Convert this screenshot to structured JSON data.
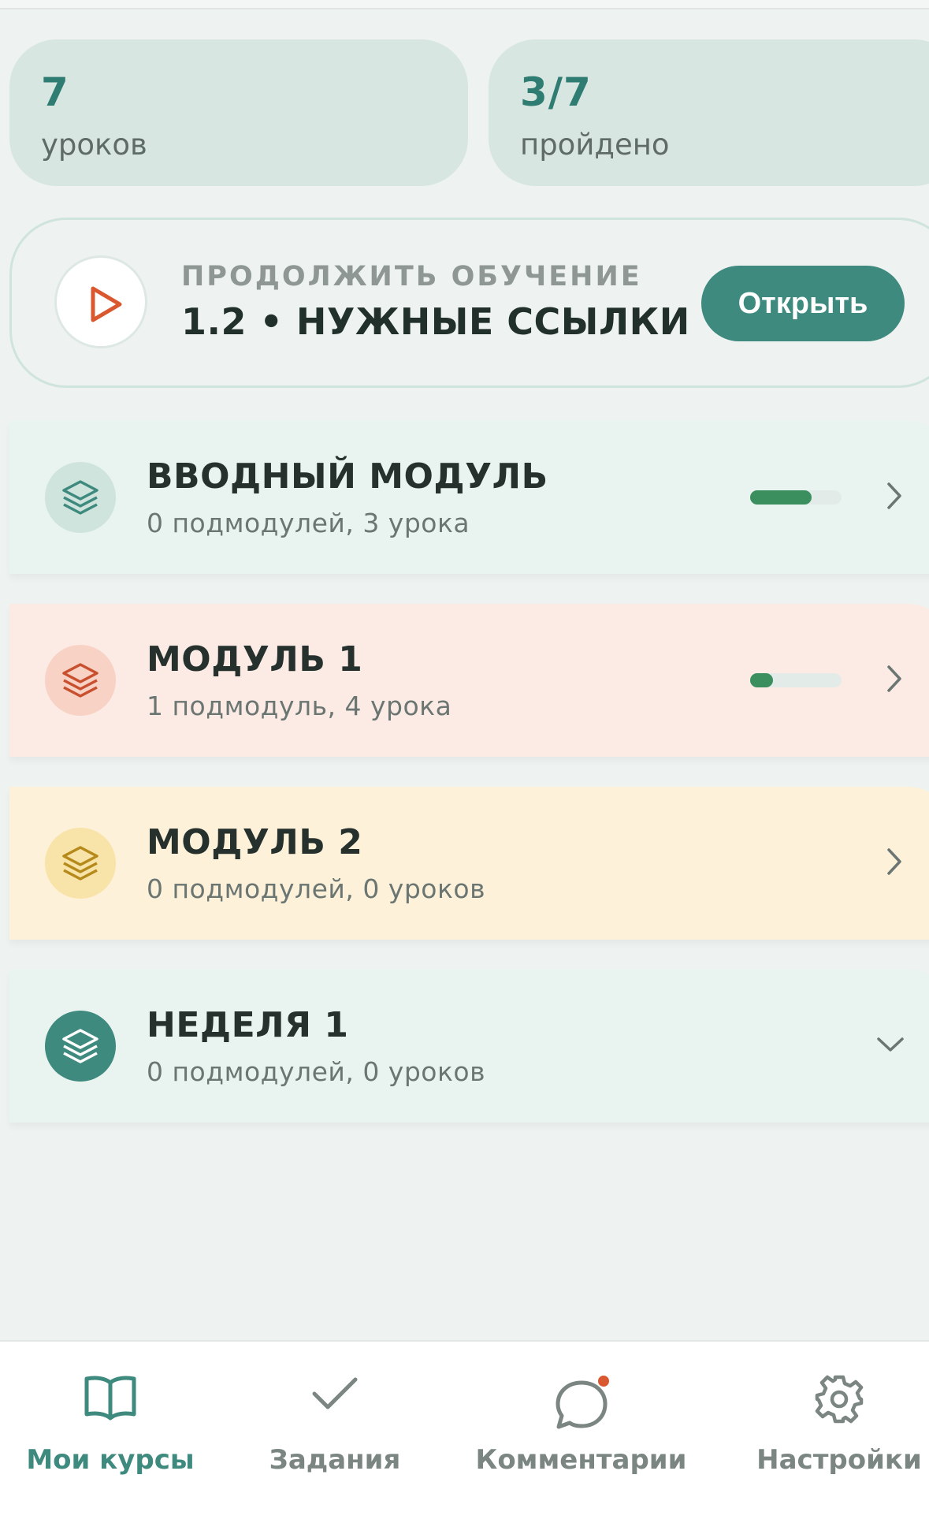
{
  "stats": {
    "lessons": {
      "value": "7",
      "label": "уроков"
    },
    "completed": {
      "value": "3/7",
      "label": "пройдено"
    }
  },
  "continue": {
    "label": "ПРОДОЛЖИТЬ ОБУЧЕНИЕ",
    "title": "1.2 • НУЖНЫЕ ССЫЛКИ",
    "button": "Открыть"
  },
  "modules": [
    {
      "title": "ВВОДНЫЙ МОДУЛЬ",
      "subtitle": "0 подмодулей, 3 урока",
      "progress": 0.67,
      "icon": "layers-icon",
      "bg": "#e9f3ef",
      "icon_bg": "#cfe4dc",
      "icon_color": "#3e8a7e",
      "chevron": "chevron-right-icon"
    },
    {
      "title": "МОДУЛЬ 1",
      "subtitle": "1 подмодуль, 4 урока",
      "progress": 0.25,
      "icon": "layers-icon",
      "bg": "#fcebe5",
      "icon_bg": "#f8d2c5",
      "icon_color": "#c9502f",
      "chevron": "chevron-right-icon"
    },
    {
      "title": "МОДУЛЬ 2",
      "subtitle": "0 подмодулей, 0 уроков",
      "progress": null,
      "icon": "layers-icon",
      "bg": "#fdf1d9",
      "icon_bg": "#f8e3a8",
      "icon_color": "#b58a1b",
      "chevron": "chevron-right-icon"
    },
    {
      "title": "НЕДЕЛЯ 1",
      "subtitle": "0 подмодулей, 0 уроков",
      "progress": null,
      "icon": "layers-icon",
      "bg": "#e9f3ef",
      "icon_bg": "#3e8a7e",
      "icon_color": "#ffffff",
      "chevron": "chevron-down-icon"
    }
  ],
  "tabs": [
    {
      "label": "Мои курсы",
      "icon": "book-icon",
      "active": true
    },
    {
      "label": "Задания",
      "icon": "check-icon",
      "active": false
    },
    {
      "label": "Комментарии",
      "icon": "comment-icon",
      "active": false,
      "badge": true
    },
    {
      "label": "Настройки",
      "icon": "gear-icon",
      "active": false
    }
  ],
  "colors": {
    "accent": "#3e8a7e",
    "progress": "#3b8f5f",
    "badge": "#d9582f"
  }
}
